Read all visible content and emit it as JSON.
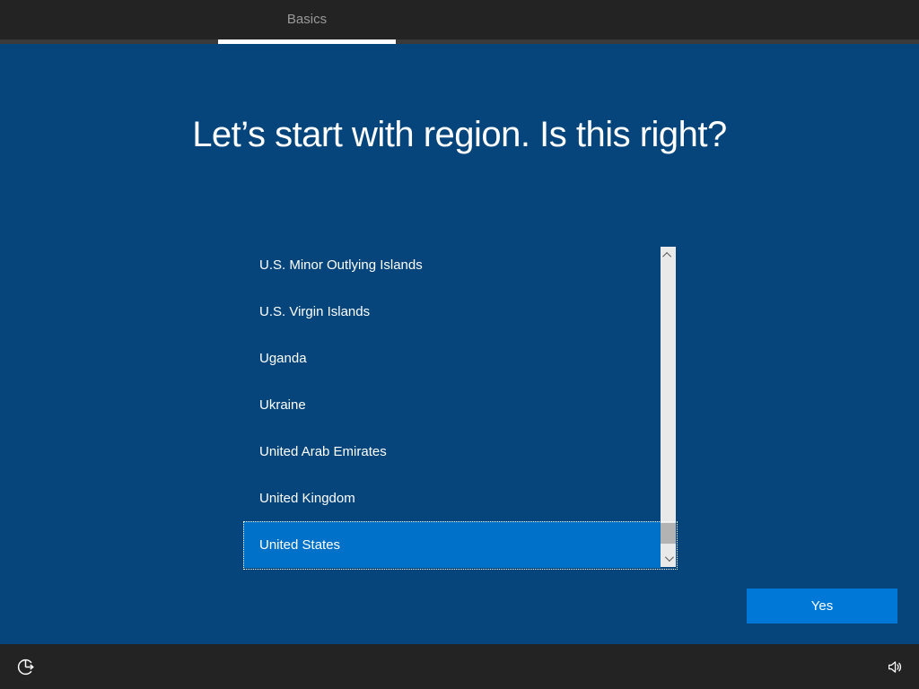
{
  "header": {
    "tab": {
      "label": "Basics"
    }
  },
  "main": {
    "title": "Let’s start with region. Is this right?",
    "region_list": {
      "items": [
        {
          "label": "U.S. Minor Outlying Islands",
          "selected": false
        },
        {
          "label": "U.S. Virgin Islands",
          "selected": false
        },
        {
          "label": "Uganda",
          "selected": false
        },
        {
          "label": "Ukraine",
          "selected": false
        },
        {
          "label": "United Arab Emirates",
          "selected": false
        },
        {
          "label": "United Kingdom",
          "selected": false
        },
        {
          "label": "United States",
          "selected": true
        }
      ],
      "selected_item": "United States",
      "scrollbar": {
        "thumb_position": "near-bottom"
      }
    },
    "yes_button": {
      "label": "Yes"
    }
  },
  "footer": {
    "left_icon": "ease-of-access-icon",
    "right_icon": "volume-icon"
  },
  "colors": {
    "background": "#05457B",
    "bar": "#232323",
    "bar_strip": "#3A3A3A",
    "tab_underline": "#FFFFFF",
    "selection": "#0071C8",
    "accent_button": "#0078D7",
    "scrollbar_track": "#E9E9E9",
    "scrollbar_thumb": "#B3B3B3"
  }
}
